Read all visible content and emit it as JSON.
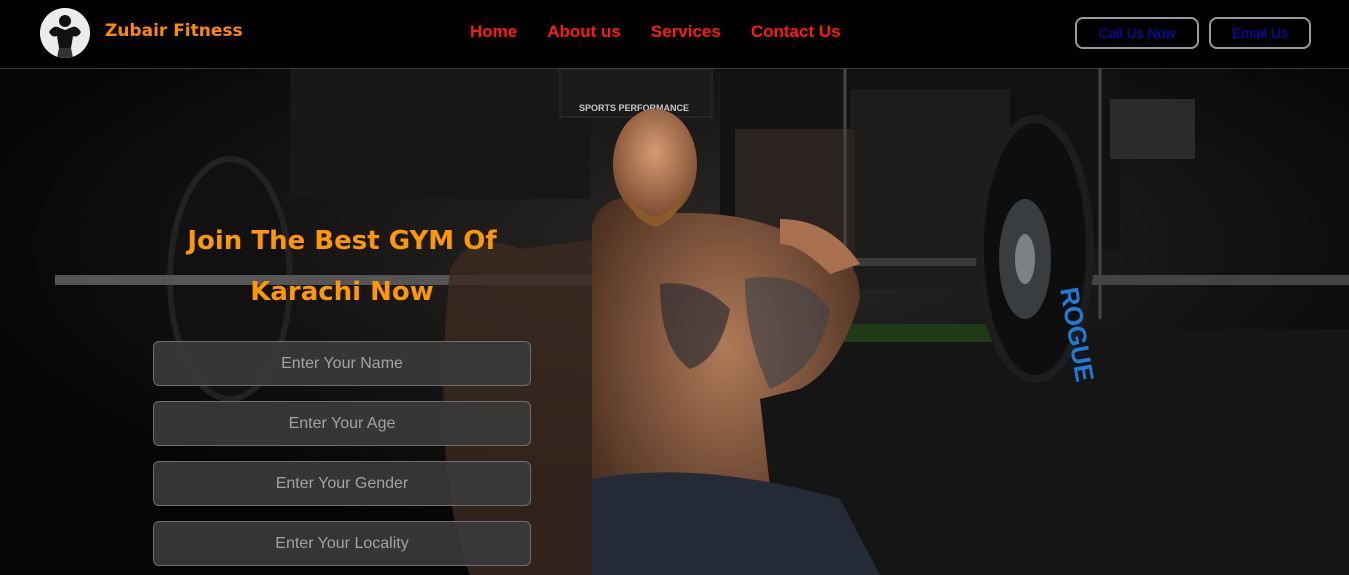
{
  "brand": {
    "name": "Zubair Fitness",
    "logo_icon": "bodybuilder-logo-icon"
  },
  "nav": {
    "links": [
      "Home",
      "About us",
      "Services",
      "Contact Us"
    ],
    "call_button": "Call Us Now",
    "email_button": "Email Us"
  },
  "hero": {
    "headline_line1": "Join The Best GYM Of",
    "headline_line2": "Karachi Now",
    "plate_brand": "ROGUE",
    "banner_text": "SPORTS PERFORMANCE",
    "form": {
      "name_placeholder": "Enter Your Name",
      "age_placeholder": "Enter Your Age",
      "gender_placeholder": "Enter Your Gender",
      "locality_placeholder": "Enter Your Locality"
    }
  },
  "colors": {
    "accent_orange": "#ff8a00",
    "nav_link_red": "#ff1a0a",
    "button_text_blue": "#0a0acd"
  }
}
